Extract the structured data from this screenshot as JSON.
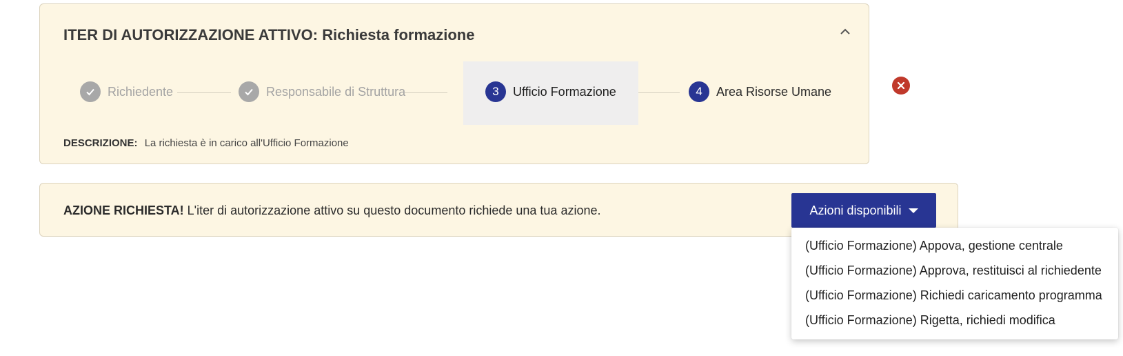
{
  "iter": {
    "title": "ITER DI AUTORIZZAZIONE ATTIVO: Richiesta formazione",
    "steps": [
      {
        "number": "",
        "label": "Richiedente",
        "state": "done"
      },
      {
        "number": "",
        "label": "Responsabile di Struttura",
        "state": "done"
      },
      {
        "number": "3",
        "label": "Ufficio Formazione",
        "state": "current"
      },
      {
        "number": "4",
        "label": "Area Risorse Umane",
        "state": "pending"
      }
    ],
    "description_label": "DESCRIZIONE:",
    "description_value": "La richiesta è in carico all'Ufficio Formazione"
  },
  "action": {
    "strong": "AZIONE RICHIESTA!",
    "message": " L'iter di autorizzazione attivo su questo documento richiede una tua azione.",
    "button_label": "Azioni disponibili",
    "options": [
      "(Ufficio Formazione) Appova, gestione centrale",
      "(Ufficio Formazione) Approva, restituisci al richiedente",
      "(Ufficio Formazione) Richiedi caricamento programma",
      "(Ufficio Formazione) Rigetta, richiedi modifica"
    ]
  },
  "colors": {
    "panel_bg": "#fdf6e3",
    "accent": "#283593",
    "done": "#a8a8a8",
    "danger": "#c0392b"
  }
}
